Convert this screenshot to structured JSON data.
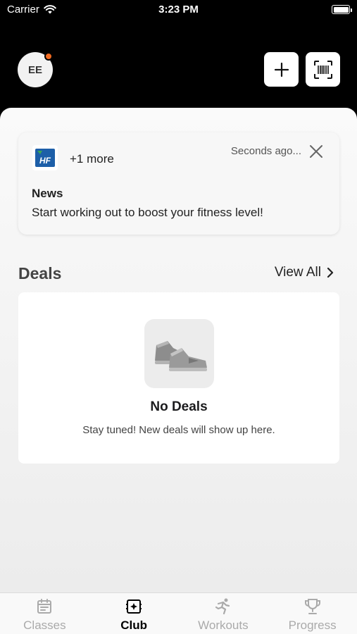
{
  "status_bar": {
    "carrier": "Carrier",
    "time": "3:23 PM"
  },
  "header": {
    "avatar_initials": "EE",
    "notification_dot_color": "#f26b21",
    "add_icon": "plus-icon",
    "scan_icon": "barcode-scan-icon"
  },
  "news": {
    "logo_text": "HF",
    "more": "+1 more",
    "time": "Seconds ago...",
    "title": "News",
    "body": "Start working out to boost your fitness level!"
  },
  "deals": {
    "title": "Deals",
    "view_all": "View All",
    "empty_title": "No Deals",
    "empty_text": "Stay tuned! New deals will show up here.",
    "empty_icon": "sneakers-icon"
  },
  "tabs": [
    {
      "label": "Classes",
      "icon": "calendar-icon",
      "active": false
    },
    {
      "label": "Club",
      "icon": "club-icon",
      "active": true
    },
    {
      "label": "Workouts",
      "icon": "running-icon",
      "active": false
    },
    {
      "label": "Progress",
      "icon": "trophy-icon",
      "active": false
    }
  ],
  "colors": {
    "accent": "#f26b21",
    "brand_blue": "#1d5fa8",
    "brand_green": "#3aa655"
  }
}
